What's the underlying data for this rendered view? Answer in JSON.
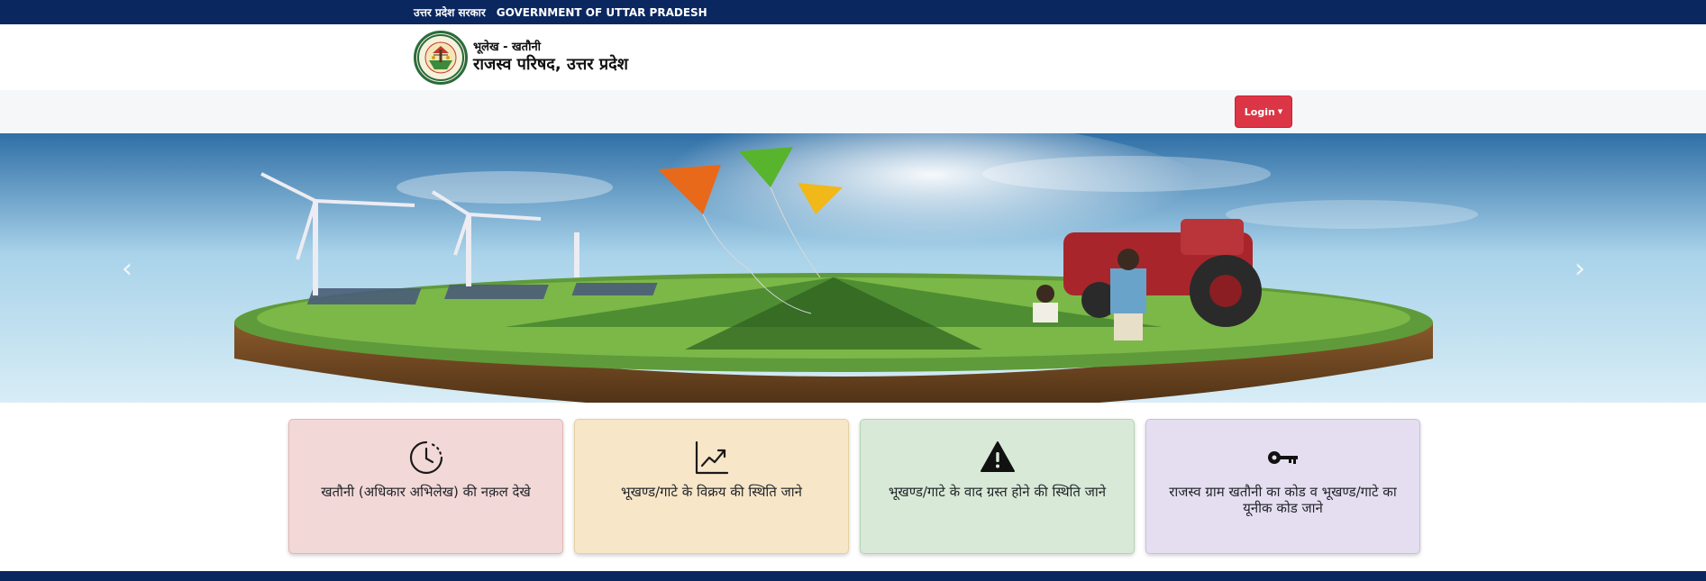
{
  "topbar": {
    "hindi_label": "उत्तर प्रदेश सरकार",
    "english_label": "GOVERNMENT OF UTTAR PRADESH"
  },
  "brand": {
    "subtitle": "भूलेख - खतौनी",
    "title": "राजस्व परिषद, उत्तर प्रदेश",
    "logo_icon": "board-of-revenue-emblem"
  },
  "navbar": {
    "login_label": "Login",
    "login_color": "#dc3545"
  },
  "carousel": {
    "prev_glyph": "‹",
    "next_glyph": "›"
  },
  "cards": [
    {
      "label": "खतौनी (अधिकार अभिलेख) की नक़ल देखे",
      "icon": "clock-history-icon",
      "color": "#f3d8d8"
    },
    {
      "label": "भूखण्ड/गाटे के विक्रय की स्थिति जाने",
      "icon": "graph-up-arrow-icon",
      "color": "#f8e6c8"
    },
    {
      "label": "भूखण्ड/गाटे के वाद ग्रस्त होने की स्थिति जाने",
      "icon": "warning-triangle-icon",
      "color": "#d8ead7"
    },
    {
      "label": "राजस्व ग्राम खतौनी का कोड व भूखण्ड/गाटे का यूनीक कोड जाने",
      "icon": "key-icon",
      "color": "#e5def1"
    }
  ],
  "colors": {
    "header_navy": "#0b2760",
    "accent_red": "#dc3545"
  }
}
